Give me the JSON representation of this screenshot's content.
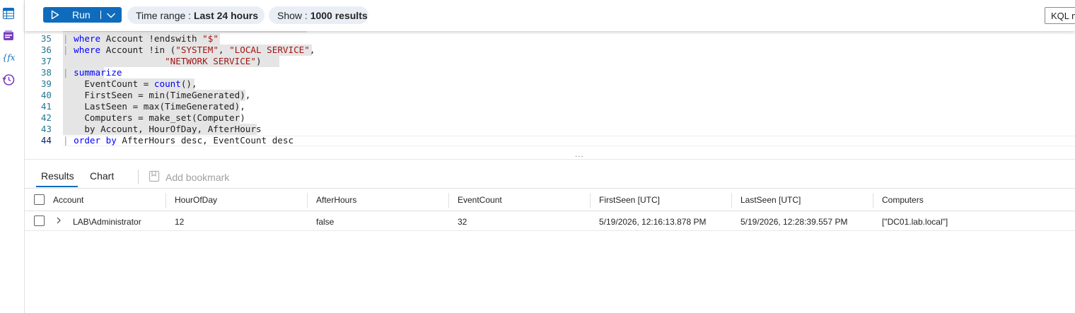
{
  "toolbar": {
    "run_label": "Run",
    "time_range_label": "Time range :",
    "time_range_value": "Last 24 hours",
    "show_label": "Show :",
    "show_value": "1000 results",
    "language_label": "KQL m"
  },
  "editor": {
    "lines": [
      {
        "num": "35",
        "parts": [
          {
            "t": "| ",
            "c": "pipe"
          },
          {
            "t": "where ",
            "c": "kw"
          },
          {
            "t": "Account !endswith ",
            "c": "plain"
          },
          {
            "t": "\"$\"",
            "c": "str"
          }
        ]
      },
      {
        "num": "36",
        "parts": [
          {
            "t": "| ",
            "c": "pipe"
          },
          {
            "t": "where ",
            "c": "kw"
          },
          {
            "t": "Account !in (",
            "c": "plain"
          },
          {
            "t": "\"SYSTEM\"",
            "c": "str"
          },
          {
            "t": ", ",
            "c": "plain"
          },
          {
            "t": "\"LOCAL SERVICE\"",
            "c": "str"
          },
          {
            "t": ",",
            "c": "plain"
          }
        ]
      },
      {
        "num": "37",
        "parts": [
          {
            "t": "                   ",
            "c": "plain"
          },
          {
            "t": "\"NETWORK SERVICE\"",
            "c": "str"
          },
          {
            "t": ")",
            "c": "plain"
          }
        ]
      },
      {
        "num": "38",
        "parts": [
          {
            "t": "| ",
            "c": "pipe"
          },
          {
            "t": "summarize",
            "c": "kw"
          }
        ]
      },
      {
        "num": "39",
        "parts": [
          {
            "t": "    EventCount = ",
            "c": "plain"
          },
          {
            "t": "count",
            "c": "fn"
          },
          {
            "t": "(),",
            "c": "plain"
          }
        ]
      },
      {
        "num": "40",
        "parts": [
          {
            "t": "    FirstSeen = min(TimeGenerated),",
            "c": "plain"
          }
        ]
      },
      {
        "num": "41",
        "parts": [
          {
            "t": "    LastSeen = max(TimeGenerated),",
            "c": "plain"
          }
        ]
      },
      {
        "num": "42",
        "parts": [
          {
            "t": "    Computers = make_set(Computer)",
            "c": "plain"
          }
        ]
      },
      {
        "num": "43",
        "parts": [
          {
            "t": "    by Account, HourOfDay, AfterHours",
            "c": "plain"
          }
        ]
      },
      {
        "num": "44",
        "parts": [
          {
            "t": "| ",
            "c": "pipe"
          },
          {
            "t": "order by ",
            "c": "kw"
          },
          {
            "t": "AfterHours desc, EventCount desc",
            "c": "plain"
          }
        ]
      }
    ]
  },
  "results": {
    "tabs": {
      "results": "Results",
      "chart": "Chart"
    },
    "add_bookmark": "Add bookmark",
    "columns": [
      "Account",
      "HourOfDay",
      "AfterHours",
      "EventCount",
      "FirstSeen [UTC]",
      "LastSeen [UTC]",
      "Computers"
    ],
    "rows": [
      [
        "LAB\\Administrator",
        "12",
        "false",
        "32",
        "5/19/2026, 12:16:13.878 PM",
        "5/19/2026, 12:28:39.557 PM",
        "[\"DC01.lab.local\"]"
      ]
    ]
  },
  "icons": {
    "rail": [
      "tables-icon",
      "queries-icon",
      "functions-icon",
      "history-icon"
    ],
    "accent": "#0f6cbd"
  }
}
